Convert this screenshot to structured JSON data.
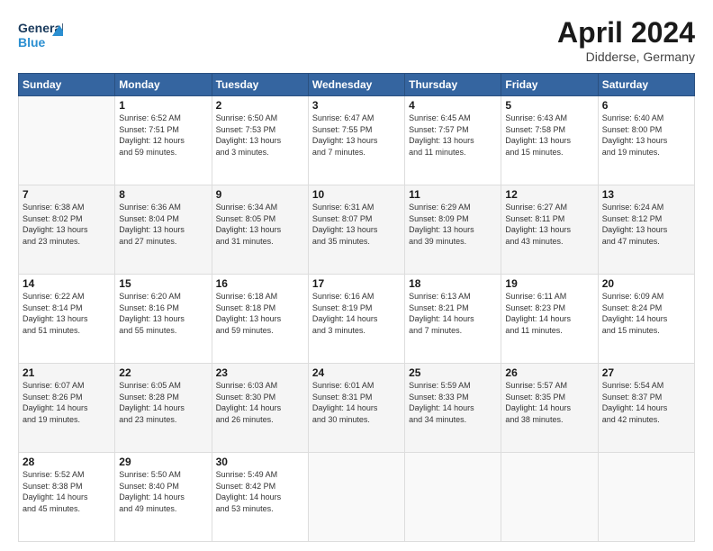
{
  "header": {
    "logo_line1": "General",
    "logo_line2": "Blue",
    "title": "April 2024",
    "subtitle": "Didderse, Germany"
  },
  "days_of_week": [
    "Sunday",
    "Monday",
    "Tuesday",
    "Wednesday",
    "Thursday",
    "Friday",
    "Saturday"
  ],
  "weeks": [
    [
      {
        "day": "",
        "detail": ""
      },
      {
        "day": "1",
        "detail": "Sunrise: 6:52 AM\nSunset: 7:51 PM\nDaylight: 12 hours\nand 59 minutes."
      },
      {
        "day": "2",
        "detail": "Sunrise: 6:50 AM\nSunset: 7:53 PM\nDaylight: 13 hours\nand 3 minutes."
      },
      {
        "day": "3",
        "detail": "Sunrise: 6:47 AM\nSunset: 7:55 PM\nDaylight: 13 hours\nand 7 minutes."
      },
      {
        "day": "4",
        "detail": "Sunrise: 6:45 AM\nSunset: 7:57 PM\nDaylight: 13 hours\nand 11 minutes."
      },
      {
        "day": "5",
        "detail": "Sunrise: 6:43 AM\nSunset: 7:58 PM\nDaylight: 13 hours\nand 15 minutes."
      },
      {
        "day": "6",
        "detail": "Sunrise: 6:40 AM\nSunset: 8:00 PM\nDaylight: 13 hours\nand 19 minutes."
      }
    ],
    [
      {
        "day": "7",
        "detail": "Sunrise: 6:38 AM\nSunset: 8:02 PM\nDaylight: 13 hours\nand 23 minutes."
      },
      {
        "day": "8",
        "detail": "Sunrise: 6:36 AM\nSunset: 8:04 PM\nDaylight: 13 hours\nand 27 minutes."
      },
      {
        "day": "9",
        "detail": "Sunrise: 6:34 AM\nSunset: 8:05 PM\nDaylight: 13 hours\nand 31 minutes."
      },
      {
        "day": "10",
        "detail": "Sunrise: 6:31 AM\nSunset: 8:07 PM\nDaylight: 13 hours\nand 35 minutes."
      },
      {
        "day": "11",
        "detail": "Sunrise: 6:29 AM\nSunset: 8:09 PM\nDaylight: 13 hours\nand 39 minutes."
      },
      {
        "day": "12",
        "detail": "Sunrise: 6:27 AM\nSunset: 8:11 PM\nDaylight: 13 hours\nand 43 minutes."
      },
      {
        "day": "13",
        "detail": "Sunrise: 6:24 AM\nSunset: 8:12 PM\nDaylight: 13 hours\nand 47 minutes."
      }
    ],
    [
      {
        "day": "14",
        "detail": "Sunrise: 6:22 AM\nSunset: 8:14 PM\nDaylight: 13 hours\nand 51 minutes."
      },
      {
        "day": "15",
        "detail": "Sunrise: 6:20 AM\nSunset: 8:16 PM\nDaylight: 13 hours\nand 55 minutes."
      },
      {
        "day": "16",
        "detail": "Sunrise: 6:18 AM\nSunset: 8:18 PM\nDaylight: 13 hours\nand 59 minutes."
      },
      {
        "day": "17",
        "detail": "Sunrise: 6:16 AM\nSunset: 8:19 PM\nDaylight: 14 hours\nand 3 minutes."
      },
      {
        "day": "18",
        "detail": "Sunrise: 6:13 AM\nSunset: 8:21 PM\nDaylight: 14 hours\nand 7 minutes."
      },
      {
        "day": "19",
        "detail": "Sunrise: 6:11 AM\nSunset: 8:23 PM\nDaylight: 14 hours\nand 11 minutes."
      },
      {
        "day": "20",
        "detail": "Sunrise: 6:09 AM\nSunset: 8:24 PM\nDaylight: 14 hours\nand 15 minutes."
      }
    ],
    [
      {
        "day": "21",
        "detail": "Sunrise: 6:07 AM\nSunset: 8:26 PM\nDaylight: 14 hours\nand 19 minutes."
      },
      {
        "day": "22",
        "detail": "Sunrise: 6:05 AM\nSunset: 8:28 PM\nDaylight: 14 hours\nand 23 minutes."
      },
      {
        "day": "23",
        "detail": "Sunrise: 6:03 AM\nSunset: 8:30 PM\nDaylight: 14 hours\nand 26 minutes."
      },
      {
        "day": "24",
        "detail": "Sunrise: 6:01 AM\nSunset: 8:31 PM\nDaylight: 14 hours\nand 30 minutes."
      },
      {
        "day": "25",
        "detail": "Sunrise: 5:59 AM\nSunset: 8:33 PM\nDaylight: 14 hours\nand 34 minutes."
      },
      {
        "day": "26",
        "detail": "Sunrise: 5:57 AM\nSunset: 8:35 PM\nDaylight: 14 hours\nand 38 minutes."
      },
      {
        "day": "27",
        "detail": "Sunrise: 5:54 AM\nSunset: 8:37 PM\nDaylight: 14 hours\nand 42 minutes."
      }
    ],
    [
      {
        "day": "28",
        "detail": "Sunrise: 5:52 AM\nSunset: 8:38 PM\nDaylight: 14 hours\nand 45 minutes."
      },
      {
        "day": "29",
        "detail": "Sunrise: 5:50 AM\nSunset: 8:40 PM\nDaylight: 14 hours\nand 49 minutes."
      },
      {
        "day": "30",
        "detail": "Sunrise: 5:49 AM\nSunset: 8:42 PM\nDaylight: 14 hours\nand 53 minutes."
      },
      {
        "day": "",
        "detail": ""
      },
      {
        "day": "",
        "detail": ""
      },
      {
        "day": "",
        "detail": ""
      },
      {
        "day": "",
        "detail": ""
      }
    ]
  ]
}
